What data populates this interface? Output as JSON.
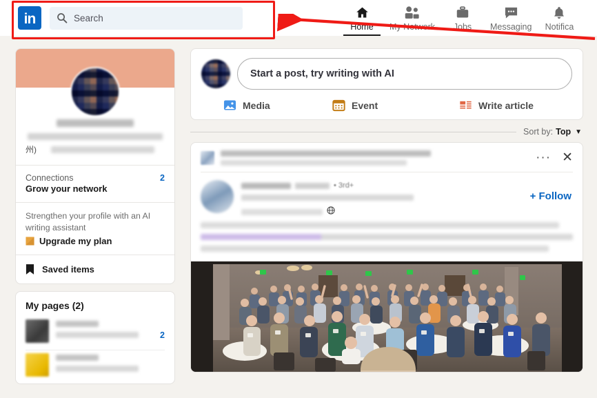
{
  "topnav": {
    "logo_text": "in",
    "logo_color": "#0a66c2",
    "search": {
      "placeholder": "Search",
      "icon": "search-icon"
    },
    "items": [
      {
        "label": "Home",
        "icon": "home-icon",
        "active": true
      },
      {
        "label": "My Network",
        "icon": "people-icon",
        "active": false
      },
      {
        "label": "Jobs",
        "icon": "briefcase-icon",
        "active": false
      },
      {
        "label": "Messaging",
        "icon": "message-bubble-icon",
        "active": false
      },
      {
        "label": "Notifica",
        "icon": "bell-icon",
        "active": false
      }
    ]
  },
  "sidebar": {
    "profile": {
      "name": "",
      "headline": "",
      "location_fragment": "州)"
    },
    "connections": {
      "label": "Connections",
      "count": "2",
      "cta": "Grow your network"
    },
    "promo": {
      "text": "Strengthen your profile with an AI writing assistant",
      "cta": "Upgrade my plan",
      "icon": "premium-badge-icon"
    },
    "saved": {
      "label": "Saved items",
      "icon": "bookmark-icon"
    },
    "pages": {
      "title": "My pages (2)",
      "items": [
        {
          "name": "",
          "subtitle": "",
          "count": "2",
          "thumb": "dark"
        },
        {
          "name": "",
          "subtitle": "",
          "count": "",
          "thumb": "yellow"
        }
      ]
    }
  },
  "feed": {
    "composer": {
      "placeholder": "Start a post, try writing with AI",
      "actions": [
        {
          "label": "Media",
          "icon": "image-icon",
          "color": "#4493e8"
        },
        {
          "label": "Event",
          "icon": "calendar-icon",
          "color": "#c37d16"
        },
        {
          "label": "Write article",
          "icon": "article-icon",
          "color": "#e16745"
        }
      ]
    },
    "sort": {
      "label": "Sort by:",
      "value": "Top",
      "caret": "chevron-down-icon"
    },
    "post": {
      "promoted_text": "",
      "menu_icon": "more-options-icon",
      "close_icon": "close-icon",
      "author_name": "",
      "author_headline": "",
      "degree": "• 3rd+",
      "visibility_icon": "globe-icon",
      "follow_label": "+ Follow",
      "body_text": "",
      "image_alt": "conference-banquet-crowd-photo"
    }
  },
  "annotations": {
    "highlight_color": "#ef1b16",
    "rect_target": "search-box-region",
    "arrow_direction": "left"
  }
}
